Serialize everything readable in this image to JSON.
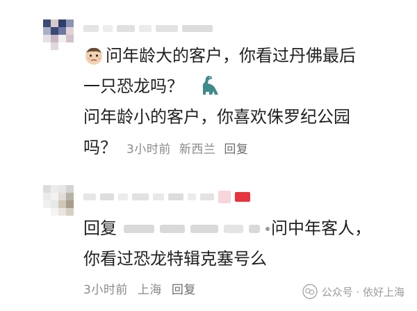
{
  "comments": [
    {
      "lines": [
        "问年龄大的客户，你看过丹佛最后",
        "一只恐龙吗？",
        "问年龄小的客户，你喜欢侏罗纪公园",
        "吗？"
      ],
      "meta": {
        "time": "3小时前",
        "location": "新西兰",
        "reply": "回复"
      },
      "stickers": [
        "face-emoji-icon",
        "dinosaur-icon"
      ]
    },
    {
      "reply_prefix": "回复",
      "lines": [
        "问中年客人，",
        "你看过恐龙特辑克塞号么"
      ],
      "meta": {
        "time": "3小时前",
        "location": "上海",
        "reply": "回复"
      }
    }
  ],
  "watermark": {
    "text": "公众号 · 依好上海"
  },
  "colors": {
    "text": "#1f1f1f",
    "meta": "#8a8a8a",
    "background": "#ffffff"
  }
}
